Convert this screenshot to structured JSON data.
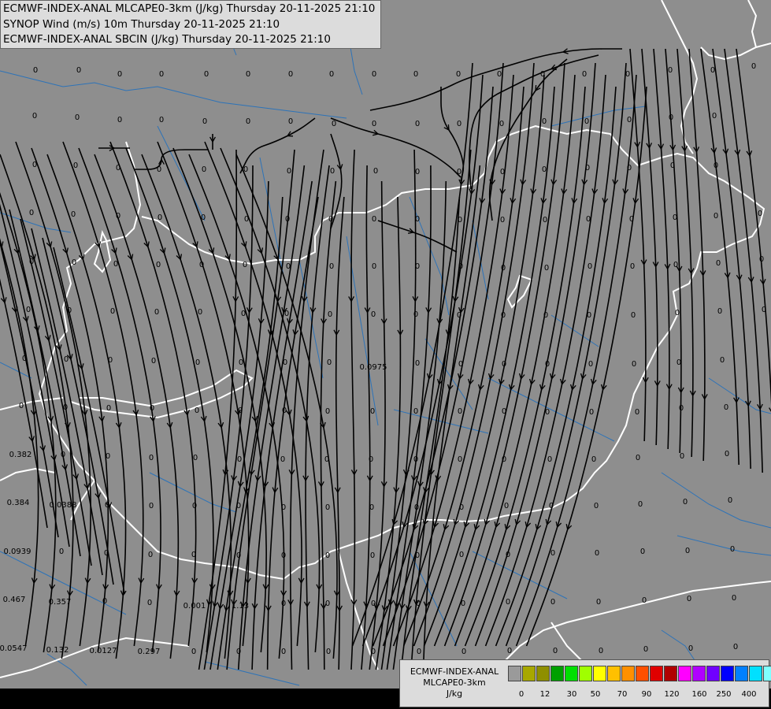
{
  "header": {
    "line1": "ECMWF-INDEX-ANAL MLCAPE0-3km (J/kg) Thursday 20-11-2025 21:10",
    "line2": "SYNOP Wind (m/s) 10m Thursday 20-11-2025 21:10",
    "line3": "ECMWF-INDEX-ANAL SBCIN (J/kg) Thursday 20-11-2025 21:10"
  },
  "legend": {
    "title_line1": "ECMWF-INDEX-ANAL",
    "title_line2": "MLCAPE0-3km",
    "title_line3": "J/kg",
    "colors": [
      "#9a9a9a",
      "#a8a800",
      "#8f8f00",
      "#00a000",
      "#00e000",
      "#a0ff00",
      "#ffff00",
      "#ffc000",
      "#ff9000",
      "#ff5000",
      "#e00000",
      "#b00000",
      "#ff00ff",
      "#b000ff",
      "#7000ff",
      "#0000ff",
      "#0080ff",
      "#00e0ff",
      "#80ffff",
      "#ffffff"
    ],
    "ticks": [
      "0",
      "12",
      "30",
      "50",
      "70",
      "90",
      "120",
      "160",
      "250",
      "400"
    ]
  },
  "map_colors": {
    "background": "#8e8e8e",
    "river": "#2d73b8",
    "border": "#ffffff",
    "streamline": "#000000",
    "value_text": "#000000"
  },
  "values": {
    "zero": "0",
    "v1": "0.0975",
    "v2": "0.382",
    "v3": "0.384",
    "v4": "0.0388",
    "v5": "0.0939",
    "v6": "0.467",
    "v7": "0.357",
    "v8": "0.001",
    "v9": "1.13",
    "v10": "0.0547",
    "v11": "0.132",
    "v12": "0.0127",
    "v13": "0.297"
  }
}
